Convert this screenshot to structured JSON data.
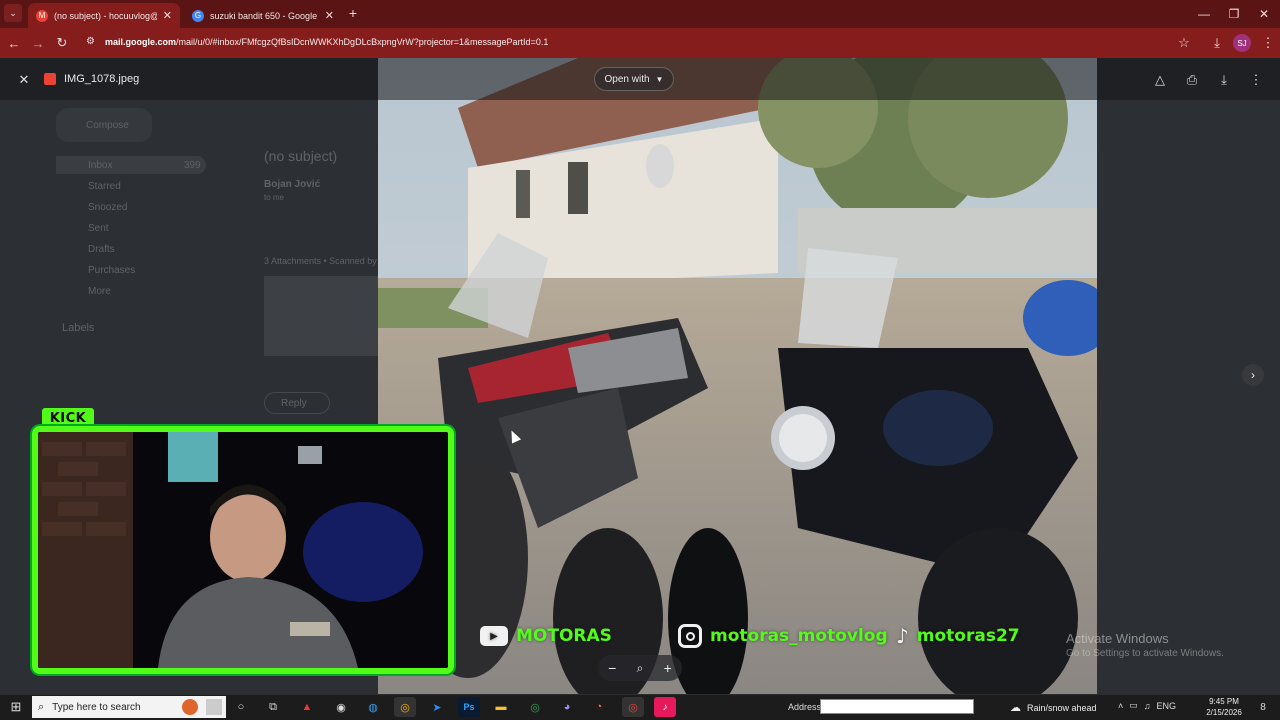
{
  "browser": {
    "tabs": [
      {
        "title": "(no subject) - hocuuvlog@gma…",
        "favicon_color": "#ea4335",
        "favicon": "M",
        "active": true
      },
      {
        "title": "suzuki bandit 650 - Google Sea…",
        "favicon_color": "#4285f4",
        "favicon": "G",
        "active": false
      }
    ],
    "url_host": "mail.google.com",
    "url_path": "/mail/u/0/#inbox/FMfcgzQfBsIDcnWWKXhDgDLcBxpngVrW?projector=1&messagePartId=0.1",
    "accent": "#861d1d"
  },
  "gmail": {
    "compose": "Compose",
    "nav": [
      "Inbox",
      "Starred",
      "Snoozed",
      "Sent",
      "Drafts",
      "Purchases",
      "More"
    ],
    "inbox_count": "399",
    "labels": "Labels",
    "subject": "(no subject)",
    "sender": "Bojan Jović",
    "to": "to me",
    "attachments": "3 Attachments • Scanned by Gmail",
    "reply": "Reply"
  },
  "viewer": {
    "filename": "IMG_1078.jpeg",
    "open_with": "Open with"
  },
  "stream": {
    "kick_label": "KICK",
    "brand_color": "#53fc18",
    "youtube": "MOTORAS",
    "instagram": "motoras_motovlog",
    "tiktok": "motoras27"
  },
  "watermark": {
    "title": "Activate Windows",
    "subtitle": "Go to Settings to activate Windows."
  },
  "taskbar": {
    "search_placeholder": "Type here to search",
    "address_label": "Address",
    "weather": "Rain/snow ahead",
    "lang": "ENG",
    "time": "9:45 PM",
    "date": "2/15/2026",
    "notifications": "8"
  }
}
